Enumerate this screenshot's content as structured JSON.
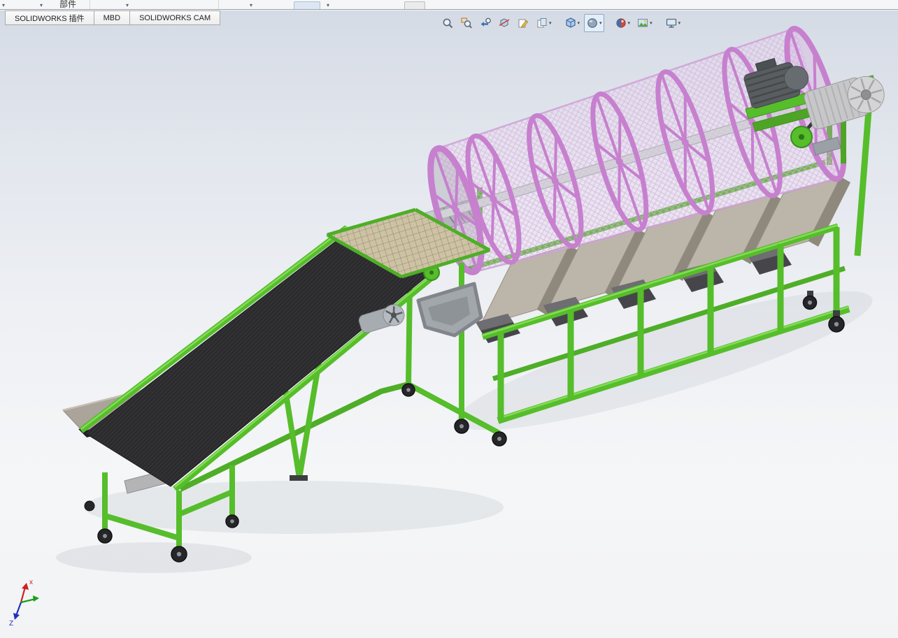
{
  "ribbon_partial": {
    "group_label": "部件"
  },
  "command_tabs": {
    "items": [
      {
        "label": "SOLIDWORKS 插件"
      },
      {
        "label": "MBD"
      },
      {
        "label": "SOLIDWORKS CAM"
      }
    ]
  },
  "heads_up_toolbar": {
    "items": [
      {
        "name": "zoom-to-fit-icon",
        "caret": false
      },
      {
        "name": "zoom-to-area-icon",
        "caret": false
      },
      {
        "name": "previous-view-icon",
        "caret": false
      },
      {
        "name": "section-view-icon",
        "caret": false
      },
      {
        "name": "3d-drawing-view-icon",
        "caret": false
      },
      {
        "name": "view-selector-icon",
        "caret": true
      },
      {
        "name": "view-orientation-icon",
        "caret": true
      },
      {
        "name": "display-style-icon",
        "caret": true,
        "active": true
      },
      {
        "name": "edit-appearance-icon",
        "caret": true
      },
      {
        "name": "apply-scene-icon",
        "caret": true
      },
      {
        "name": "view-settings-icon",
        "caret": true
      }
    ]
  },
  "viewport": {
    "triad": {
      "x_label": "x",
      "z_label": "Z"
    },
    "colors": {
      "frame_green": "#56bd2b",
      "drum_ring_pink": "#c680ce",
      "drum_mesh_pink": "#d9a8df",
      "belt_black": "#2b2b2e",
      "hopper_tan": "#bcb5a9",
      "chute_dark": "#46464a",
      "motor_light_gray": "#c7c7c9",
      "motor_dark_gray": "#585d60",
      "shaft_gray": "#d2d3d7",
      "background_top": "#d5dbe5",
      "background_bottom": "#f2f3f5"
    },
    "model": {
      "description": "trommel drum screening machine with inclined feed belt conveyor",
      "parts": [
        {
          "name": "feed-hopper-conveyor"
        },
        {
          "name": "inclined-belt-conveyor"
        },
        {
          "name": "transfer-mesh-conveyor"
        },
        {
          "name": "feed-auger-roller"
        },
        {
          "name": "trommel-drum-screen"
        },
        {
          "name": "drum-shaft"
        },
        {
          "name": "collection-hoppers"
        },
        {
          "name": "discharge-chutes"
        },
        {
          "name": "support-frame"
        },
        {
          "name": "casters"
        },
        {
          "name": "drive-motor-large"
        },
        {
          "name": "drive-motor-dark"
        },
        {
          "name": "hopper-drive-motor"
        }
      ]
    }
  }
}
